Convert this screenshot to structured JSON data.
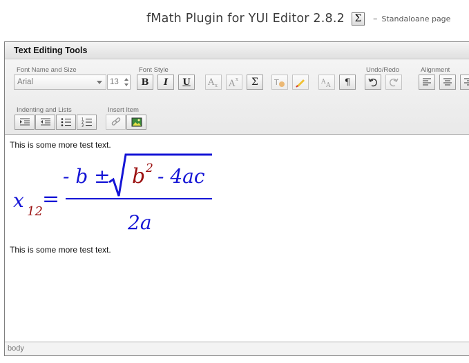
{
  "page": {
    "title": "fMath Plugin for YUI Editor 2.8.2",
    "dash": "–",
    "subtitle": "Standaloane page",
    "sigma_symbol": "Σ"
  },
  "editor": {
    "title": "Text Editing Tools",
    "groups": {
      "font_name_size": "Font Name and Size",
      "font_style": "Font Style",
      "undo_redo": "Undo/Redo",
      "alignment": "Alignment",
      "indenting_lists": "Indenting and Lists",
      "insert_item": "Insert Item"
    },
    "font_name_value": "Arial",
    "font_size_value": "13",
    "buttons": {
      "bold": "B",
      "italic": "I",
      "underline": "U",
      "sigma": "Σ",
      "paragraph": "¶"
    },
    "content": {
      "paragraph_1": "This is some more test text.",
      "paragraph_2": "This is some more test text.",
      "formula": {
        "var": "x",
        "subscript": "12",
        "equals": "=",
        "numerator_prefix": "- b ±",
        "radicand_base": "b",
        "radicand_exp": "2",
        "radicand_rest": "- 4ac",
        "denominator": "2a",
        "color_main": "#1515d6",
        "color_accent": "#9b1010"
      }
    },
    "status": "body"
  }
}
